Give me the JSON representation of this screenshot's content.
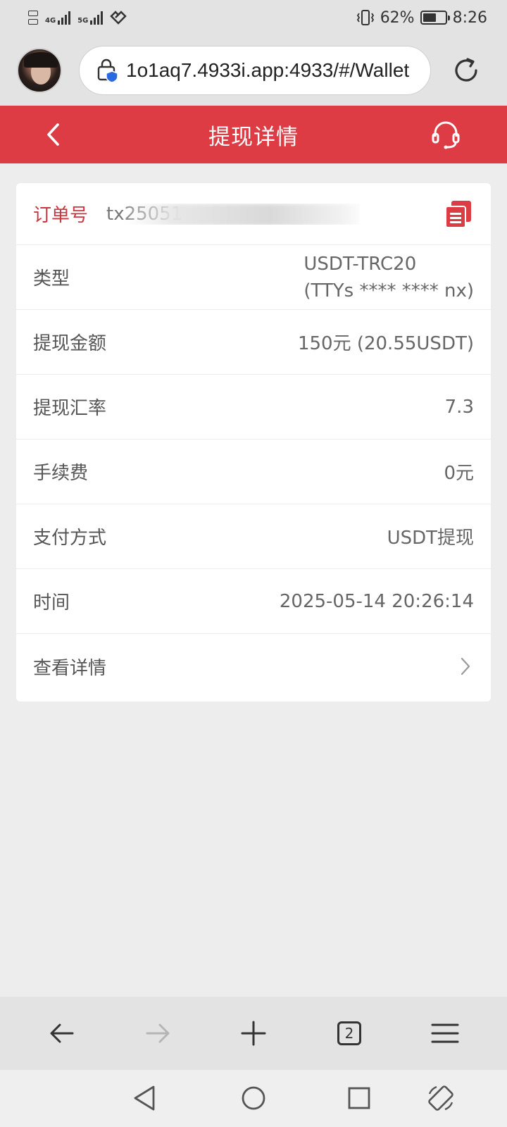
{
  "status_bar": {
    "network_1": "4G",
    "network_2": "5G",
    "battery_percent": "62%",
    "battery_level": 0.62,
    "time": "8:26"
  },
  "browser": {
    "url": "1o1aq7.4933i.app:4933/#/Wallet",
    "tab_count": "2"
  },
  "header": {
    "title": "提现详情"
  },
  "details": {
    "order_label": "订单号",
    "order_value": "tx25051",
    "type_label": "类型",
    "type_value_line1": "USDT-TRC20",
    "type_value_line2": "(TTYs **** **** nx)",
    "amount_label": "提现金额",
    "amount_value": "150元 (20.55USDT)",
    "rate_label": "提现汇率",
    "rate_value": "7.3",
    "fee_label": "手续费",
    "fee_value": "0元",
    "method_label": "支付方式",
    "method_value": "USDT提现",
    "time_label": "时间",
    "time_value": "2025-05-14 20:26:14",
    "more_label": "查看详情"
  },
  "colors": {
    "brand_red": "#de3c44",
    "order_label_red": "#c9363e",
    "secure_blue": "#2a6ae0"
  }
}
